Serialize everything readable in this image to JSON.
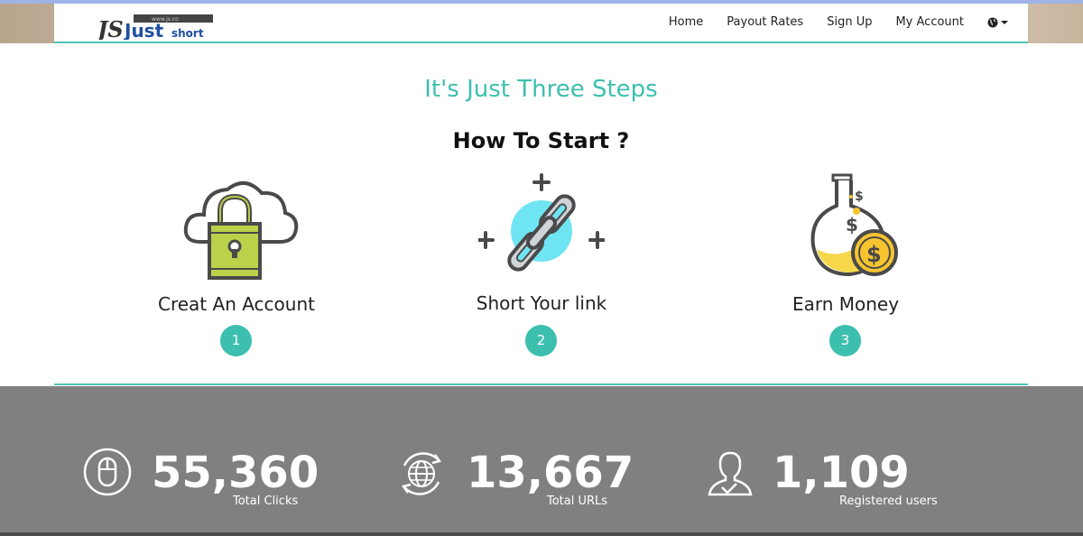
{
  "logo": {
    "letters": "JS",
    "word": "Just",
    "suffix": "short",
    "tagline": "www.js.co"
  },
  "nav": {
    "items": [
      "Home",
      "Payout Rates",
      "Sign Up",
      "My Account"
    ],
    "language_icon": "globe-icon"
  },
  "hero": {
    "subtitle": "It's Just Three Steps",
    "title": "How To Start ?"
  },
  "steps": [
    {
      "label": "Creat An Account",
      "number": "1",
      "icon": "cloud-lock-icon"
    },
    {
      "label": "Short Your link",
      "number": "2",
      "icon": "chain-link-icon"
    },
    {
      "label": "Earn Money",
      "number": "3",
      "icon": "money-flask-icon"
    }
  ],
  "stats": [
    {
      "value": "55,360",
      "label": "Total Clicks",
      "icon": "mouse-icon"
    },
    {
      "value": "13,667",
      "label": "Total URLs",
      "icon": "globe-refresh-icon"
    },
    {
      "value": "1,109",
      "label": "Registered users",
      "icon": "user-check-icon"
    }
  ],
  "colors": {
    "accent": "#3dbfae",
    "stats_bg": "#808080",
    "text": "#222222"
  }
}
